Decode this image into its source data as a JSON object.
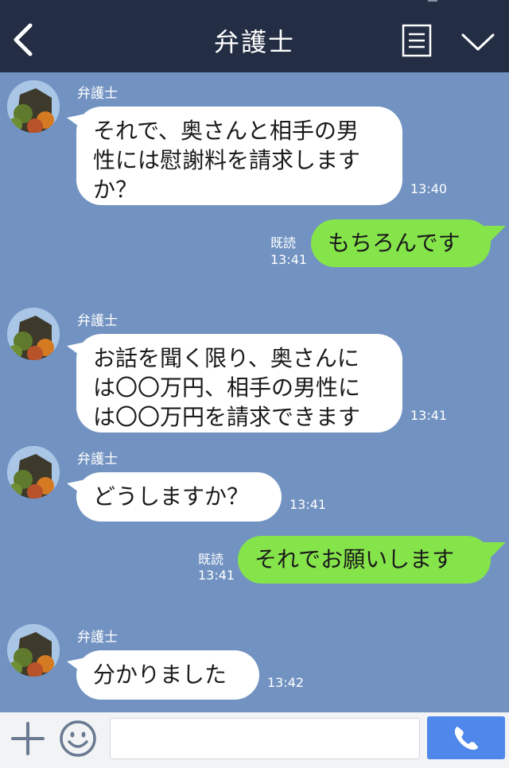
{
  "header": {
    "title": "弁護士",
    "back_icon": "chevron-left-icon",
    "menu_icon": "menu-list-icon",
    "collapse_icon": "chevron-down-icon",
    "background": "#232d43"
  },
  "chat": {
    "background": "#7293c2",
    "incoming_color": "#ffffff",
    "outgoing_color": "#86e44b",
    "messages": [
      {
        "from": "弁護士",
        "text": "それで、奥さんと相手の男\n性には慰謝料を請求しますか？",
        "time": "13:40"
      },
      {
        "status": "既読",
        "text": "もちろんです",
        "time": "13:41"
      },
      {
        "from": "弁護士",
        "text": "お話を聞く限り、奥さんに\nは〇〇万円、相手の男性に\nは〇〇万円を請求できます",
        "time": "13:41"
      },
      {
        "from": "弁護士",
        "text": "どうしますか？",
        "time": "13:41"
      },
      {
        "status": "既読",
        "text": "それでお願いします",
        "time": "13:41"
      },
      {
        "from": "弁護士",
        "text": "分かりました",
        "time": "13:42"
      }
    ]
  },
  "input_bar": {
    "plus_icon": "plus-icon",
    "emoji_icon": "smiley-icon",
    "message_value": "",
    "call_icon": "phone-icon",
    "call_color": "#4f87ea"
  }
}
